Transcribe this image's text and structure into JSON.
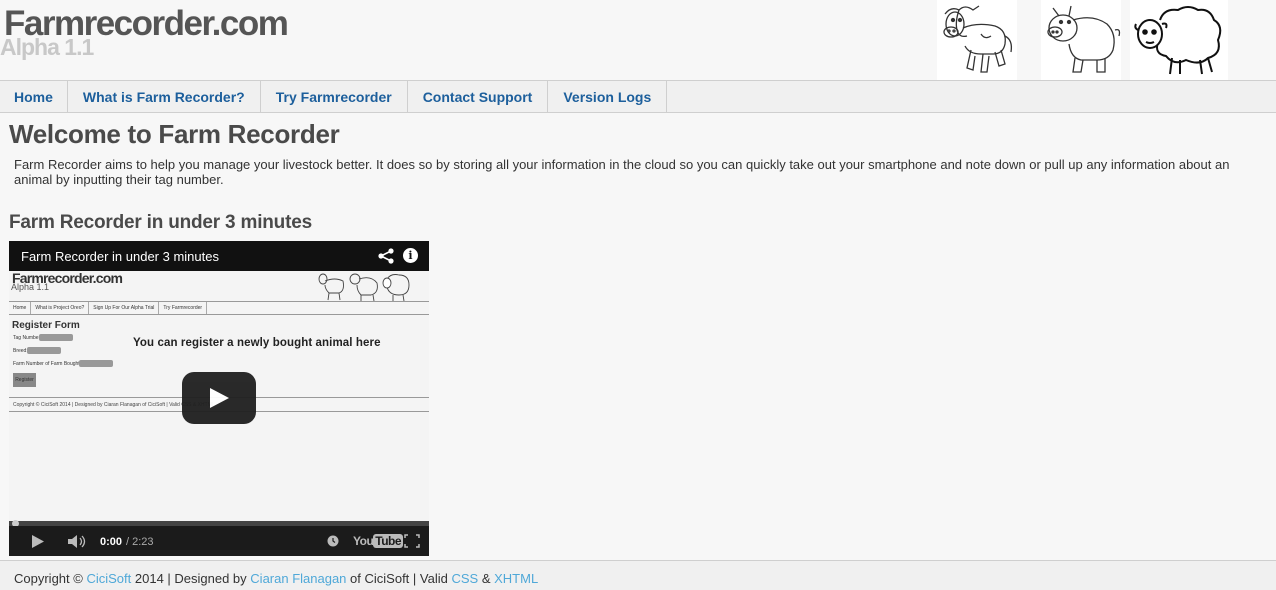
{
  "header": {
    "site_title": "Farmrecorder.com",
    "site_version": "Alpha 1.1",
    "animals": [
      "cow-icon",
      "pig-icon",
      "sheep-icon"
    ]
  },
  "nav": {
    "items": [
      {
        "label": "Home"
      },
      {
        "label": "What is Farm Recorder?"
      },
      {
        "label": "Try Farmrecorder"
      },
      {
        "label": "Contact Support"
      },
      {
        "label": "Version Logs"
      }
    ],
    "link_color": "#1d5f9c"
  },
  "main": {
    "title": "Welcome to Farm Recorder",
    "intro": "Farm Recorder aims to help you manage your livestock better. It does so by storing all your information in the cloud so you can quickly take out your smartphone and note down or pull up any information about an animal by inputting their tag number.",
    "subtitle": "Farm Recorder in under 3 minutes"
  },
  "video": {
    "title": "Farm Recorder in under 3 minutes",
    "current_time": "0:00",
    "duration": "2:23",
    "time_separator": "/ 2:23",
    "progress": 0.0,
    "logo_you": "You",
    "logo_tube": "Tube",
    "frame": {
      "site_title": "Farmrecorder.com",
      "site_version": "Alpha 1.1",
      "nav": [
        "Home",
        "What is Project Oreo?",
        "Sign Up For Our Alpha Trial",
        "Try Farmrecorder"
      ],
      "form_title": "Register Form",
      "fields": [
        "Tag Number:",
        "Breed:",
        "Farm Number of Farm Bought of:"
      ],
      "button": "Register",
      "caption": "You can register a newly bought animal here",
      "footer": "Copyright © CiciSoft 2014 | Designed by Ciaran Flanagan of CiciSoft | Valid CSS & XHTML"
    }
  },
  "footer": {
    "copyright_prefix": "Copyright ©",
    "company": "CiciSoft",
    "year_designed": "2014 | Designed by",
    "designer": "Ciaran Flanagan",
    "of_text": "of CiciSoft | Valid",
    "css_link": "CSS",
    "amp": "&",
    "xhtml_link": "XHTML",
    "link_color": "#4fa8d8"
  }
}
